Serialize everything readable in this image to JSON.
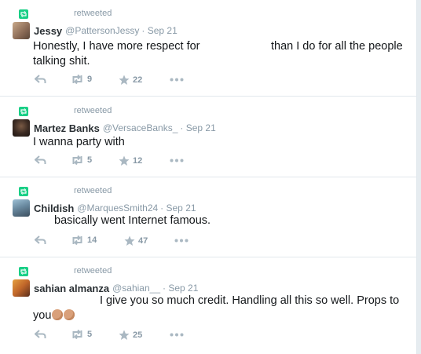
{
  "tweets": [
    {
      "retweet_label": "retweeted",
      "name": "Jessy",
      "handle": "@PattersonJessy",
      "date": "· Sep 21",
      "text_part1": "Honestly, I have more respect for",
      "text_part2": "than I do for all the people",
      "text_part3": "talking shit.",
      "retweets": "9",
      "likes": "22"
    },
    {
      "retweet_label": "retweeted",
      "name": "Martez Banks",
      "handle": "@VersaceBanks_",
      "date": "· Sep 21",
      "text_part1": "I wanna party with",
      "retweets": "5",
      "likes": "12"
    },
    {
      "retweet_label": "retweeted",
      "name": "Childish",
      "handle": "@MarquesSmith24",
      "date": "· Sep 21",
      "text_part1": "basically went Internet famous.",
      "retweets": "14",
      "likes": "47"
    },
    {
      "retweet_label": "retweeted",
      "name": "sahian almanza",
      "handle": "@sahian__",
      "date": "· Sep 21",
      "text_part1": "I give you so much credit. Handling all this so well. Props to",
      "text_part2": "you",
      "retweets": "5",
      "likes": "25"
    }
  ],
  "colors": {
    "retweet_green": "#19cf86",
    "meta_gray": "#8899a6",
    "icon_gray": "#aab8c2",
    "divider": "#e1e8ed"
  },
  "icons": [
    "retweet-badge-icon",
    "reply-icon",
    "retweet-icon",
    "like-star-icon",
    "more-icon",
    "clapping-hands-emoji"
  ]
}
